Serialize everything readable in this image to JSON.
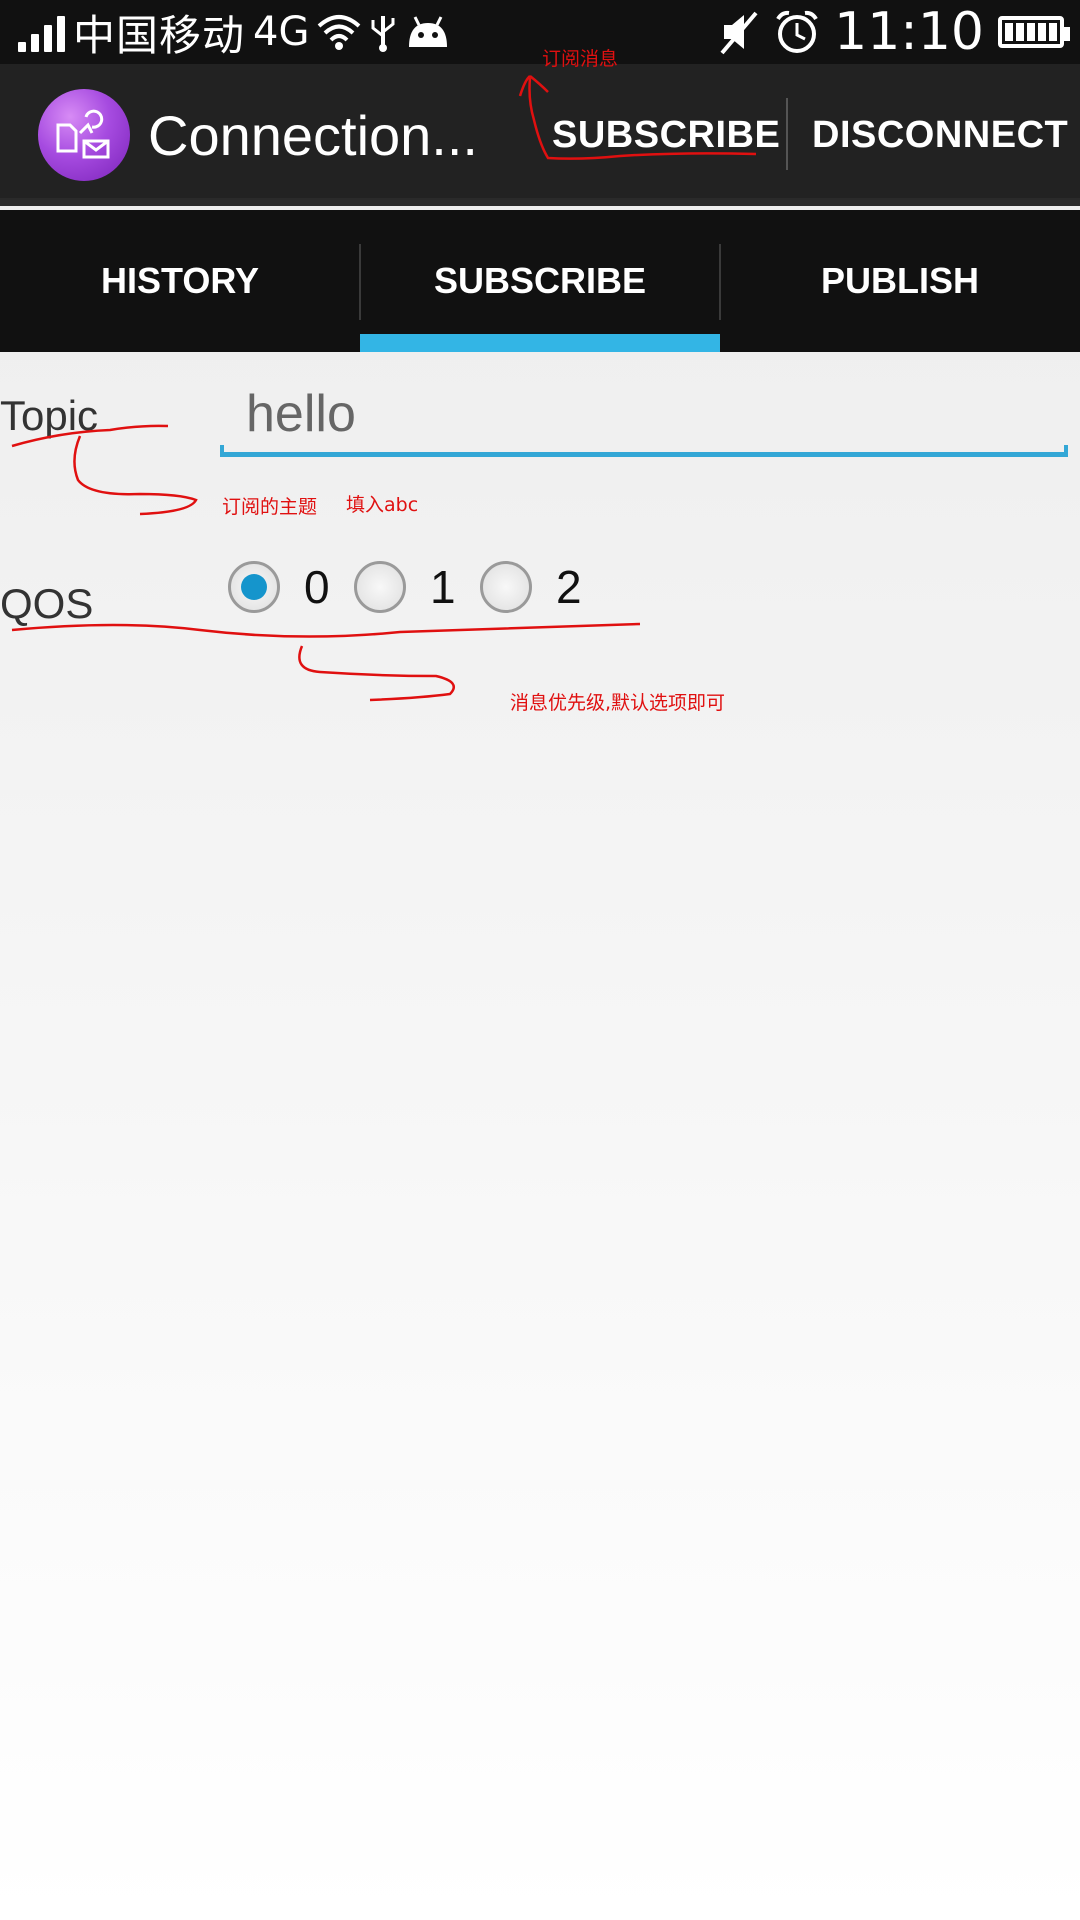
{
  "status_bar": {
    "carrier": "中国移动",
    "network": "4G",
    "time": "11:10",
    "icons": [
      "signal-icon",
      "wifi-icon",
      "usb-icon",
      "android-icon",
      "mute-icon",
      "alarm-icon",
      "battery-icon"
    ]
  },
  "action_bar": {
    "title": "Connection...",
    "subscribe_label": "SUBSCRIBE",
    "disconnect_label": "DISCONNECT"
  },
  "tabs": [
    {
      "label": "HISTORY",
      "selected": false
    },
    {
      "label": "SUBSCRIBE",
      "selected": true
    },
    {
      "label": "PUBLISH",
      "selected": false
    }
  ],
  "form": {
    "topic_label": "Topic",
    "topic_value": "hello",
    "qos_label": "QOS",
    "qos_options": [
      "0",
      "1",
      "2"
    ],
    "qos_selected": "0"
  },
  "annotations": {
    "subscribe_note": "订阅消息",
    "topic_note": "订阅的主题",
    "topic_fill_note": "填入abc",
    "qos_note": "消息优先级,默认选项即可"
  },
  "colors": {
    "accent": "#33b5e5",
    "annotation": "#e01010",
    "radio_checked": "#1595cc"
  }
}
